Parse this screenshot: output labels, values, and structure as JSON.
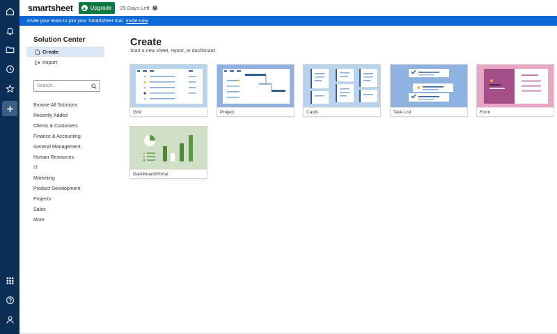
{
  "app": {
    "logo": "smartsheet",
    "upgrade_label": "Upgrade",
    "trial_days": "29 Days Left"
  },
  "banner": {
    "text": "Invite your team to join your Smartsheet trial.",
    "link": "Invite now"
  },
  "sidebar": {
    "title": "Solution Center",
    "nav": [
      {
        "label": "Create"
      },
      {
        "label": "Import"
      }
    ],
    "search_placeholder": "Search...",
    "categories": [
      "Browse All Solutions",
      "Recently Added",
      "Clients & Customers",
      "Finance & Accounting",
      "General Management",
      "Human Resources",
      "IT",
      "Marketing",
      "Product Development",
      "Projects",
      "Sales",
      "More"
    ]
  },
  "main": {
    "title": "Create",
    "subtitle": "Start a new sheet, report, or dashboard",
    "templates": [
      {
        "label": "Grid",
        "bg": "#b9d3ec"
      },
      {
        "label": "Project",
        "bg": "#8fb3e0"
      },
      {
        "label": "Cards",
        "bg": "#b9d3ec"
      },
      {
        "label": "Task List",
        "bg": "#8fb3e0"
      },
      {
        "label": "Form",
        "bg": "#e8a6c5"
      },
      {
        "label": "Dashboard/Portal",
        "bg": "#cfe0c6"
      }
    ]
  },
  "colors": {
    "rail": "#0b2e57",
    "banner": "#0d68d8",
    "upgrade": "#0b7a3e",
    "active_nav": "#dbe7f5"
  },
  "icons": {
    "rail": [
      "home-icon",
      "bell-icon",
      "folder-icon",
      "clock-icon",
      "star-icon",
      "plus-icon",
      "apps-grid-icon",
      "help-icon",
      "user-icon"
    ]
  }
}
